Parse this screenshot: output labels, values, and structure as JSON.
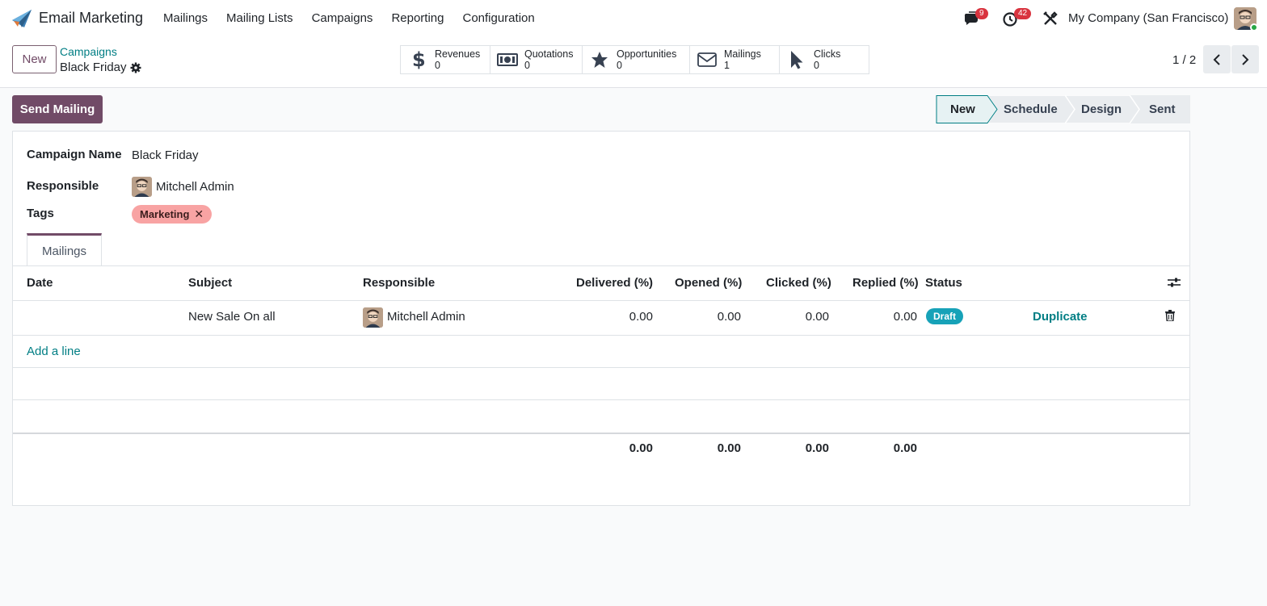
{
  "app": {
    "name": "Email Marketing"
  },
  "menu": [
    "Mailings",
    "Mailing Lists",
    "Campaigns",
    "Reporting",
    "Configuration"
  ],
  "systray": {
    "messages_count": "9",
    "activities_count": "42",
    "company": "My Company (San Francisco)"
  },
  "control": {
    "new_label": "New",
    "breadcrumb_parent": "Campaigns",
    "breadcrumb_current": "Black Friday",
    "pager": "1 / 2"
  },
  "stats": [
    {
      "label": "Revenues",
      "value": "0",
      "icon": "dollar-icon"
    },
    {
      "label": "Quotations",
      "value": "0",
      "icon": "banknote-icon"
    },
    {
      "label": "Opportunities",
      "value": "0",
      "icon": "star-icon"
    },
    {
      "label": "Mailings",
      "value": "1",
      "icon": "envelope-icon"
    },
    {
      "label": "Clicks",
      "value": "0",
      "icon": "cursor-icon"
    }
  ],
  "actions": {
    "send_mailing": "Send Mailing"
  },
  "stages": {
    "items": [
      "New",
      "Schedule",
      "Design",
      "Sent"
    ],
    "active": "New"
  },
  "form": {
    "campaign_name_label": "Campaign Name",
    "campaign_name": "Black Friday",
    "responsible_label": "Responsible",
    "responsible": "Mitchell Admin",
    "tags_label": "Tags",
    "tags": [
      "Marketing"
    ]
  },
  "tab": {
    "label": "Mailings"
  },
  "table": {
    "columns": [
      "Date",
      "Subject",
      "Responsible",
      "Delivered (%)",
      "Opened (%)",
      "Clicked (%)",
      "Replied (%)",
      "Status"
    ],
    "rows": [
      {
        "date": "",
        "subject": "New Sale On all",
        "responsible": "Mitchell Admin",
        "delivered": "0.00",
        "opened": "0.00",
        "clicked": "0.00",
        "replied": "0.00",
        "status": "Draft",
        "action": "Duplicate"
      }
    ],
    "add_line": "Add a line",
    "totals": {
      "delivered": "0.00",
      "opened": "0.00",
      "clicked": "0.00",
      "replied": "0.00"
    }
  },
  "colors": {
    "brand": "#714b67",
    "link": "#017e84",
    "badge": "#d9343f",
    "draft": "#17a2b8",
    "tag": "#f8a3a3"
  }
}
